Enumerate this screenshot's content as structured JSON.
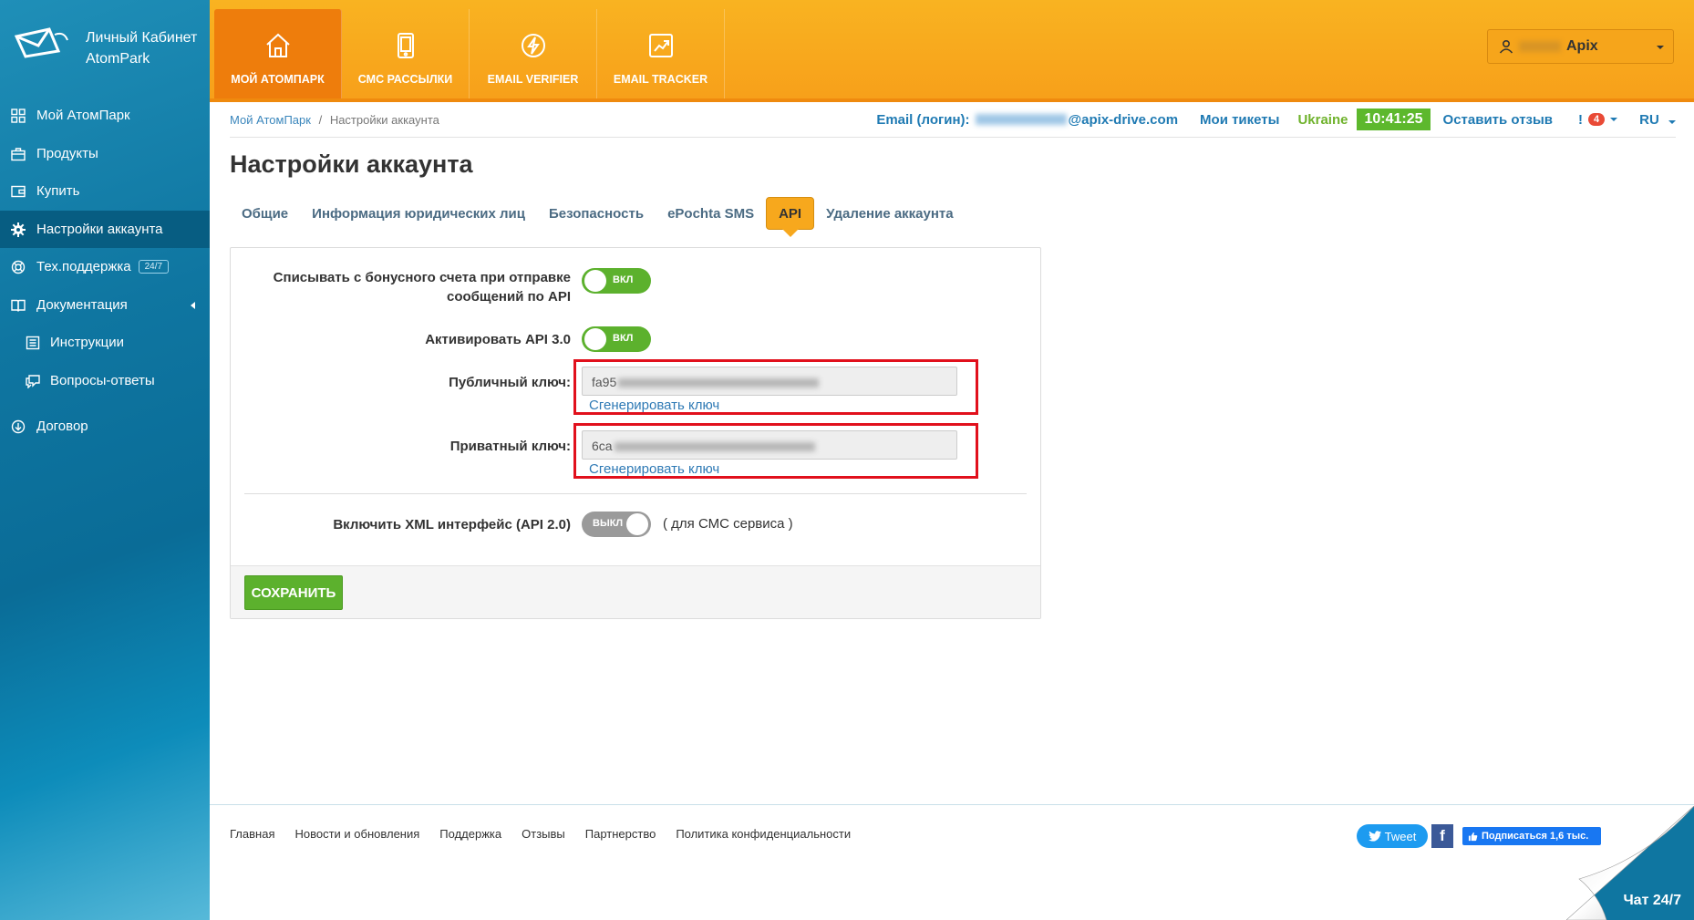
{
  "app": {
    "logo_line1": "Личный Кабинет",
    "logo_line2": "AtomPark"
  },
  "sidebar": {
    "items": [
      {
        "label": "Мой АтомПарк",
        "icon": "grid-icon"
      },
      {
        "label": "Продукты",
        "icon": "briefcase-icon"
      },
      {
        "label": "Купить",
        "icon": "wallet-icon"
      },
      {
        "label": "Настройки аккаунта",
        "icon": "gear-icon",
        "active": true
      },
      {
        "label": "Тех.поддержка",
        "icon": "lifebuoy-icon",
        "badge": "24/7"
      },
      {
        "label": "Документация",
        "icon": "book-icon"
      },
      {
        "label": "Инструкции",
        "icon": "list-icon"
      },
      {
        "label": "Вопросы-ответы",
        "icon": "chat-icon"
      },
      {
        "label": "Договор",
        "icon": "download-icon"
      }
    ]
  },
  "topnav": {
    "items": [
      {
        "label": "Мой АтомПарк",
        "icon": "home-icon",
        "active": true
      },
      {
        "label": "СМС рассылки",
        "icon": "phone-icon"
      },
      {
        "label": "Email Verifier",
        "icon": "lightning-icon"
      },
      {
        "label": "Email Tracker",
        "icon": "chart-up-icon"
      }
    ],
    "user_name": "Apix"
  },
  "breadcrumb": {
    "home": "Мой АтомПарк",
    "separator": "/",
    "current": "Настройки аккаунта"
  },
  "info": {
    "email_label": "Email (логин):",
    "email_domain": "@apix-drive.com",
    "tickets": "Мои тикеты",
    "country": "Ukraine",
    "time": "10:41:25",
    "feedback": "Оставить отзыв",
    "notif_icon": "!",
    "notif_count": "4",
    "lang": "RU"
  },
  "page": {
    "title": "Настройки аккаунта",
    "tabs": [
      {
        "label": "Общие"
      },
      {
        "label": "Информация юридических лиц"
      },
      {
        "label": "Безопасность"
      },
      {
        "label": "ePochta SMS"
      },
      {
        "label": "API",
        "active": true
      },
      {
        "label": "Удаление аккаунта"
      }
    ]
  },
  "form": {
    "bonus_label_line1": "Списывать с бонусного счета при отправке",
    "bonus_label_line2": "сообщений по API",
    "bonus_state": "ВКЛ",
    "api3_label": "Активировать API 3.0",
    "api3_state": "ВКЛ",
    "public_key_label": "Публичный ключ:",
    "public_key_prefix": "fa95",
    "private_key_label": "Приватный ключ:",
    "private_key_prefix": "6ca",
    "generate_link": "Сгенерировать ключ",
    "xml_label": "Включить XML интерфейс (API 2.0)",
    "xml_state": "ВЫКЛ",
    "xml_note": "( для СМС сервиса )",
    "save_label": "Сохранить"
  },
  "footer": {
    "links": [
      "Главная",
      "Новости и обновления",
      "Поддержка",
      "Отзывы",
      "Партнерство",
      "Политика конфиденциальности"
    ],
    "tweet": "Tweet",
    "fb_letter": "f",
    "fb_like": "Подписаться 1,6 тыс.",
    "chat": "Чат 24/7"
  },
  "colors": {
    "accent_orange": "#f7a81d",
    "sidebar_blue": "#0f76a1",
    "switch_on": "#5cb12d",
    "highlight_red": "#e1101c"
  }
}
